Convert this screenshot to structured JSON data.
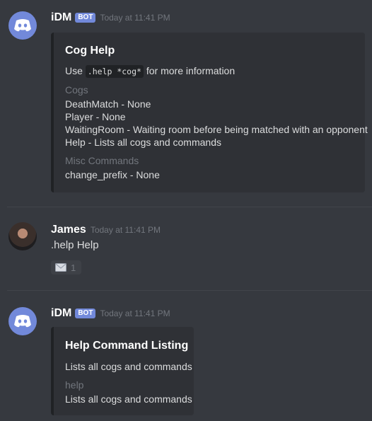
{
  "messages": [
    {
      "username": "iDM",
      "bot_tag": "BOT",
      "timestamp": "Today at 11:41 PM",
      "embed": {
        "title": "Cog Help",
        "desc_prefix": "Use ",
        "desc_code": ".help *cog*",
        "desc_suffix": " for more information",
        "fields": [
          {
            "name": "Cogs",
            "lines": [
              "DeathMatch - None",
              "Player - None",
              "WaitingRoom - Waiting room before being matched with an opponent",
              "Help - Lists all cogs and commands"
            ]
          },
          {
            "name": "Misc Commands",
            "lines": [
              "change_prefix - None"
            ]
          }
        ]
      }
    },
    {
      "username": "James",
      "timestamp": "Today at 11:41 PM",
      "text": ".help Help",
      "reaction": {
        "icon": "envelope-icon",
        "count": "1"
      }
    },
    {
      "username": "iDM",
      "bot_tag": "BOT",
      "timestamp": "Today at 11:41 PM",
      "embed": {
        "title": "Help Command Listing",
        "description": "Lists all cogs and commands",
        "fields": [
          {
            "name": "help",
            "lines": [
              "Lists all cogs and commands"
            ]
          }
        ]
      }
    }
  ],
  "colors": {
    "background": "#36393f",
    "embed_bg": "#2f3136",
    "blurple": "#7289da",
    "muted": "#72767d"
  }
}
